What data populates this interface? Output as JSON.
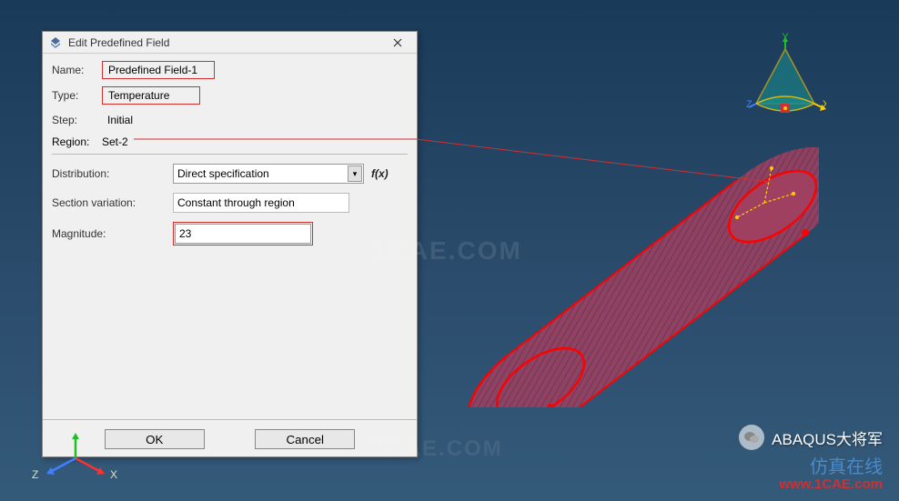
{
  "dialog": {
    "title": "Edit Predefined Field",
    "name_label": "Name:",
    "name_value": "Predefined Field-1",
    "type_label": "Type:",
    "type_value": "Temperature",
    "step_label": "Step:",
    "step_value": "Initial",
    "region_label": "Region:",
    "region_value": "Set-2",
    "distribution_label": "Distribution:",
    "distribution_value": "Direct specification",
    "fx_label": "f(x)",
    "section_variation_label": "Section variation:",
    "section_variation_value": "Constant through region",
    "magnitude_label": "Magnitude:",
    "magnitude_value": "23",
    "ok": "OK",
    "cancel": "Cancel"
  },
  "axes": {
    "x": "X",
    "y": "Y",
    "z": "Z"
  },
  "watermark": "1CAE.COM",
  "branding": {
    "wechat": "ABAQUS大将军",
    "site_cn": "仿真在线",
    "site_url": "www.1CAE.com"
  }
}
